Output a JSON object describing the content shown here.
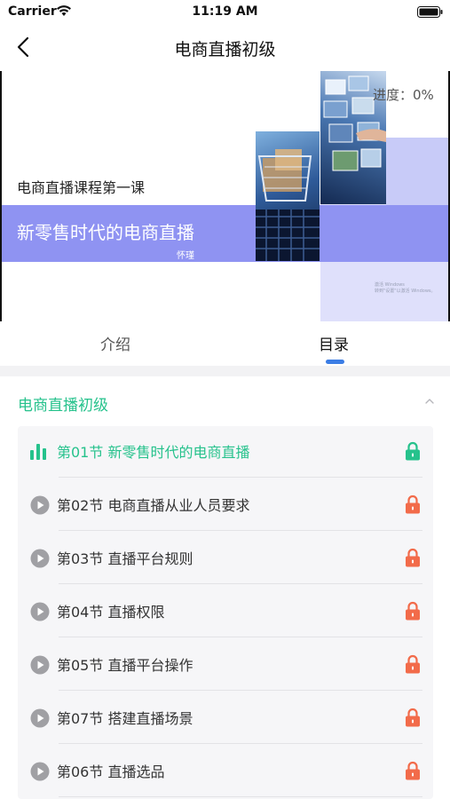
{
  "status_bar": {
    "carrier": "Carrier",
    "time": "11:19 AM"
  },
  "nav": {
    "title": "电商直播初级",
    "back_icon": "chevron-left-icon"
  },
  "cover": {
    "progress": "进度：0%",
    "subtitle": "电商直播课程第一课",
    "headline": "新零售时代的电商直播",
    "author": "怀瑾",
    "watermark_line1": "激活 Windows",
    "watermark_line2": "转到\"设置\"以激活 Windows。",
    "band_color": "#8f93f2"
  },
  "tabs": [
    {
      "label": "介绍",
      "active": false
    },
    {
      "label": "目录",
      "active": true
    }
  ],
  "chapter": {
    "title": "电商直播初级",
    "expanded": true
  },
  "lessons": [
    {
      "label": "第01节  新零售时代的电商直播",
      "state": "playing",
      "locked": false
    },
    {
      "label": "第02节  电商直播从业人员要求",
      "state": "idle",
      "locked": true
    },
    {
      "label": "第03节  直播平台规则",
      "state": "idle",
      "locked": true
    },
    {
      "label": "第04节  直播权限",
      "state": "idle",
      "locked": true
    },
    {
      "label": "第05节  直播平台操作",
      "state": "idle",
      "locked": true
    },
    {
      "label": "第07节  搭建直播场景",
      "state": "idle",
      "locked": true
    },
    {
      "label": "第06节  直播选品",
      "state": "idle",
      "locked": true
    }
  ],
  "colors": {
    "accent_green": "#26c28c",
    "lock_red": "#f26b4a",
    "tab_indicator": "#3b7de5"
  }
}
